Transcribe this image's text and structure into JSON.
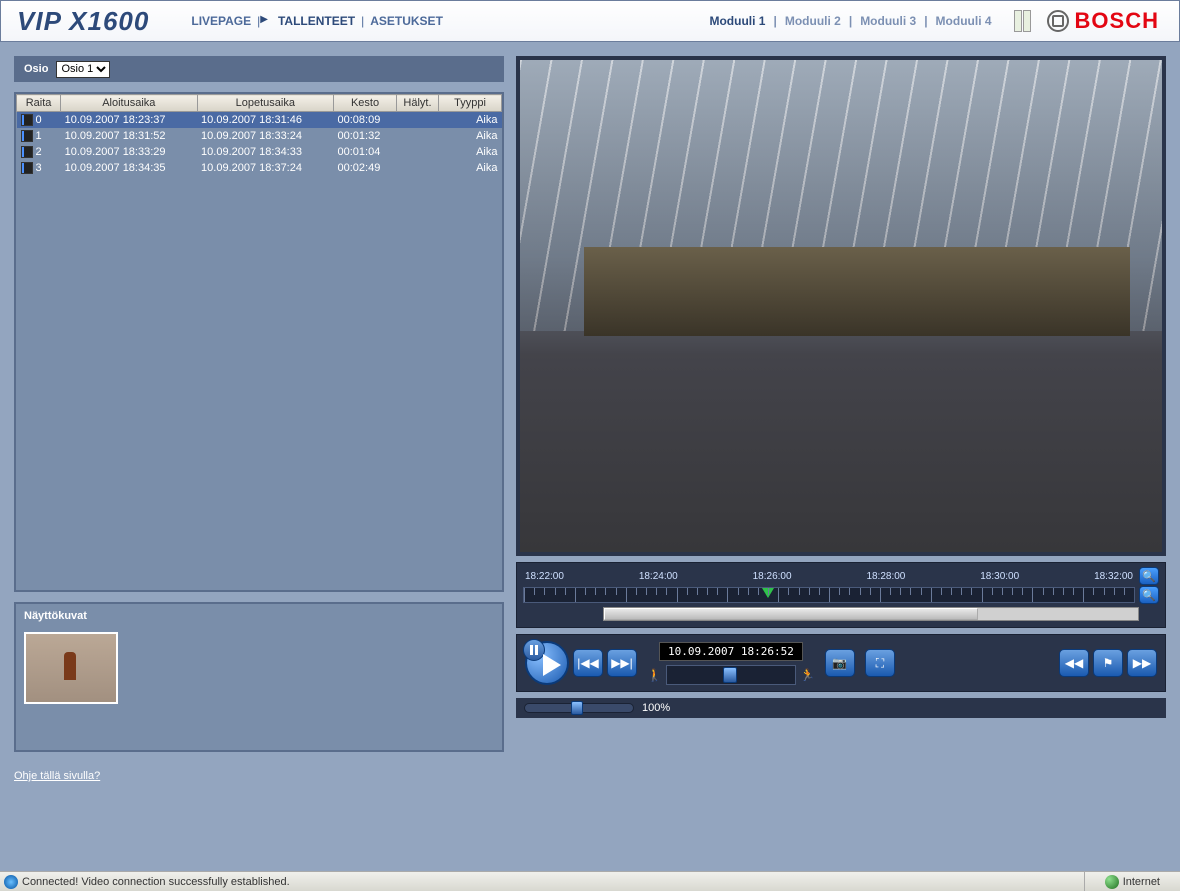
{
  "product_name": "VIP X1600",
  "brand": "BOSCH",
  "nav": {
    "livepage": "LIVEPAGE",
    "recordings": "TALLENTEET",
    "settings": "ASETUKSET"
  },
  "modules": {
    "m1": "Moduuli 1",
    "m2": "Moduuli 2",
    "m3": "Moduuli 3",
    "m4": "Moduuli 4"
  },
  "osio": {
    "label": "Osio",
    "selected": "Osio 1"
  },
  "columns": {
    "raita": "Raita",
    "start": "Aloitusaika",
    "end": "Lopetusaika",
    "dur": "Kesto",
    "halyt": "Hälyt.",
    "tyyppi": "Tyyppi"
  },
  "rows": [
    {
      "n": "0",
      "start": "10.09.2007 18:23:37",
      "end": "10.09.2007 18:31:46",
      "dur": "00:08:09",
      "halyt": "",
      "tyyppi": "Aika"
    },
    {
      "n": "1",
      "start": "10.09.2007 18:31:52",
      "end": "10.09.2007 18:33:24",
      "dur": "00:01:32",
      "halyt": "",
      "tyyppi": "Aika"
    },
    {
      "n": "2",
      "start": "10.09.2007 18:33:29",
      "end": "10.09.2007 18:34:33",
      "dur": "00:01:04",
      "halyt": "",
      "tyyppi": "Aika"
    },
    {
      "n": "3",
      "start": "10.09.2007 18:34:35",
      "end": "10.09.2007 18:37:24",
      "dur": "00:02:49",
      "halyt": "",
      "tyyppi": "Aika"
    }
  ],
  "screenshots_title": "Näyttökuvat",
  "help_link": "Ohje tällä sivulla?",
  "timeline_labels": [
    "18:22:00",
    "18:24:00",
    "18:26:00",
    "18:28:00",
    "18:30:00",
    "18:32:00"
  ],
  "playback_timestamp": "10.09.2007 18:26:52",
  "zoom_value": "100%",
  "status_text": "Connected! Video connection successfully established.",
  "zone_text": "Internet"
}
